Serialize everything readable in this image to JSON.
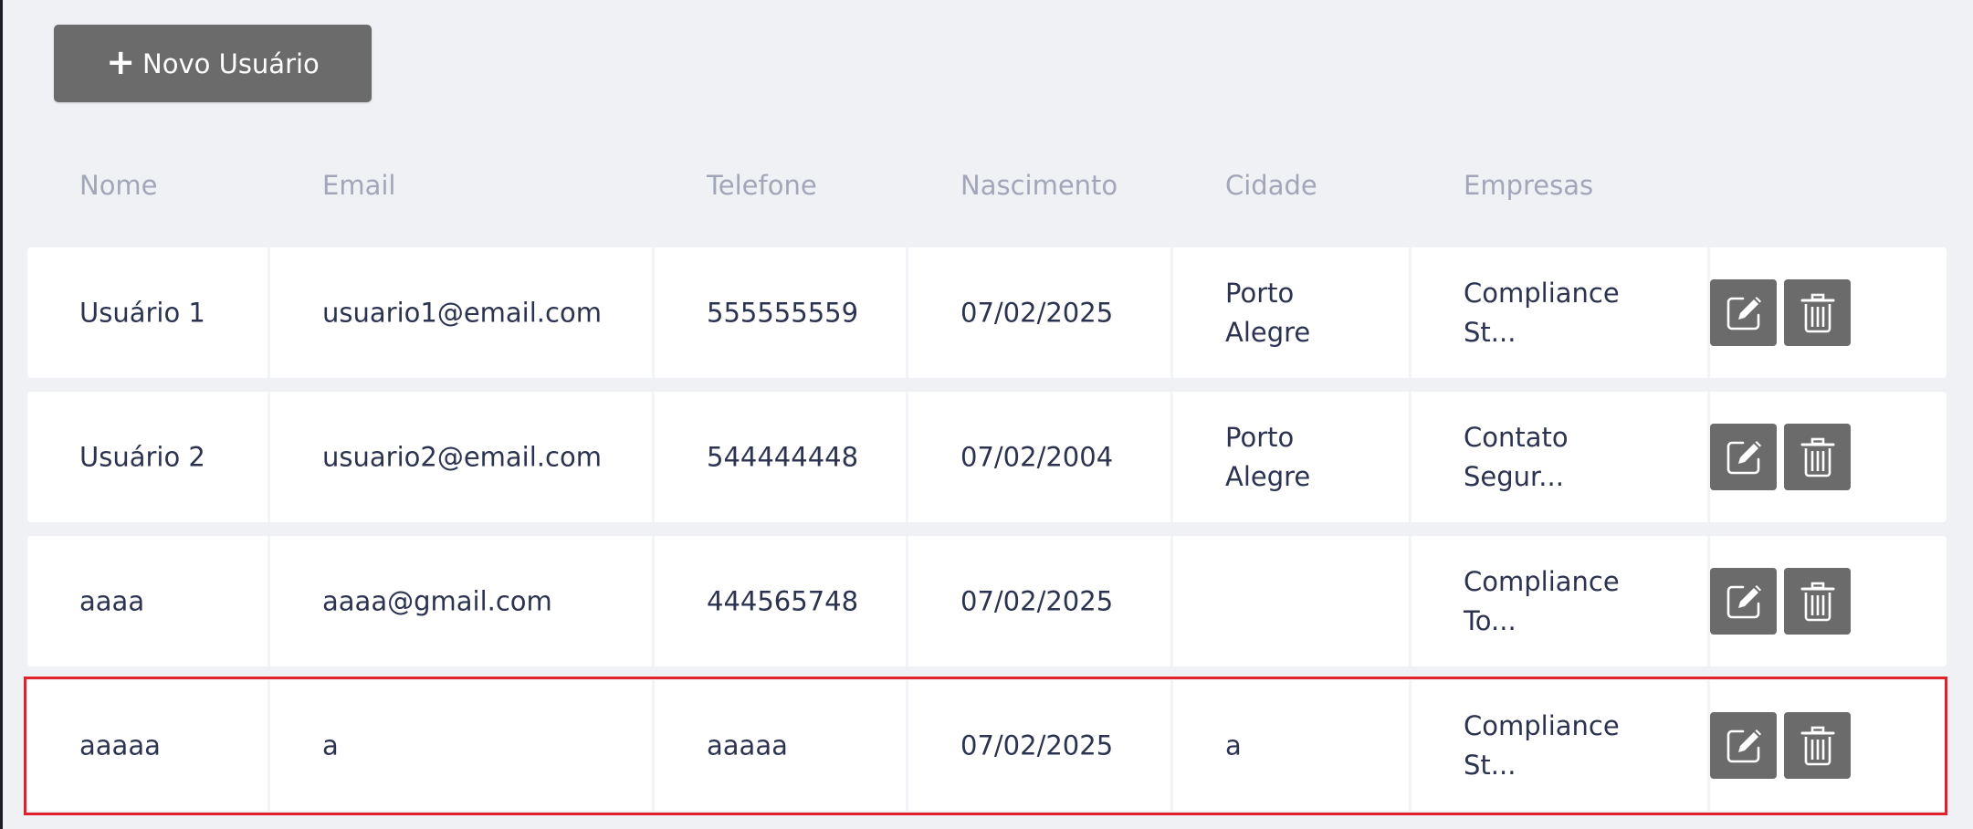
{
  "toolbar": {
    "new_user_label": "Novo Usuário",
    "new_user_icon": "plus-icon"
  },
  "table": {
    "columns": [
      "Nome",
      "Email",
      "Telefone",
      "Nascimento",
      "Cidade",
      "Empresas"
    ],
    "rows": [
      {
        "nome": "Usuário 1",
        "email": "usuario1@email.com",
        "telefone": "555555559",
        "nascimento": "07/02/2025",
        "cidade": "Porto Alegre",
        "empresas": "Compliance St..."
      },
      {
        "nome": "Usuário 2",
        "email": "usuario2@email.com",
        "telefone": "544444448",
        "nascimento": "07/02/2004",
        "cidade": "Porto Alegre",
        "empresas": "Contato Segur..."
      },
      {
        "nome": "aaaa",
        "email": "aaaa@gmail.com",
        "telefone": "444565748",
        "nascimento": "07/02/2025",
        "cidade": "",
        "empresas": "Compliance To..."
      },
      {
        "nome": "aaaaa",
        "email": "a",
        "telefone": "aaaaa",
        "nascimento": "07/02/2025",
        "cidade": "a",
        "empresas": "Compliance St..."
      }
    ],
    "actions": {
      "edit_icon": "edit-icon",
      "delete_icon": "trash-icon"
    }
  },
  "colors": {
    "background": "#f0f1f5",
    "button": "#6b6b6b",
    "row": "#ffffff",
    "header_text": "#a2a6b8",
    "body_text": "#2b3350",
    "highlight": "#e0202a"
  }
}
